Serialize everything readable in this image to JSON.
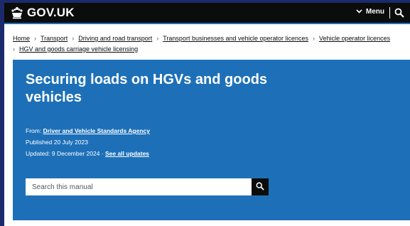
{
  "header": {
    "logo_text": "GOV.UK",
    "logo_icon": "crown-icon",
    "menu_label": "Menu",
    "menu_icon": "chevron-down-icon",
    "search_icon": "search-icon"
  },
  "breadcrumb": [
    "Home",
    "Transport",
    "Driving and road transport",
    "Transport businesses and vehicle operator licences",
    "Vehicle operator licences",
    "HGV and goods carriage vehicle licensing"
  ],
  "hero": {
    "title": "Securing loads on HGVs and goods vehicles",
    "from_label": "From:",
    "from_org": "Driver and Vehicle Standards Agency",
    "published_label": "Published",
    "published_date": "20 July 2023",
    "updated_label": "Updated:",
    "updated_date": "9 December 2024 ·",
    "see_updates": "See all updates"
  },
  "search": {
    "placeholder": "Search this manual",
    "icon": "search-icon"
  },
  "colors": {
    "header_bg": "#0b0c0c",
    "brand_blue": "#1d70b8"
  }
}
